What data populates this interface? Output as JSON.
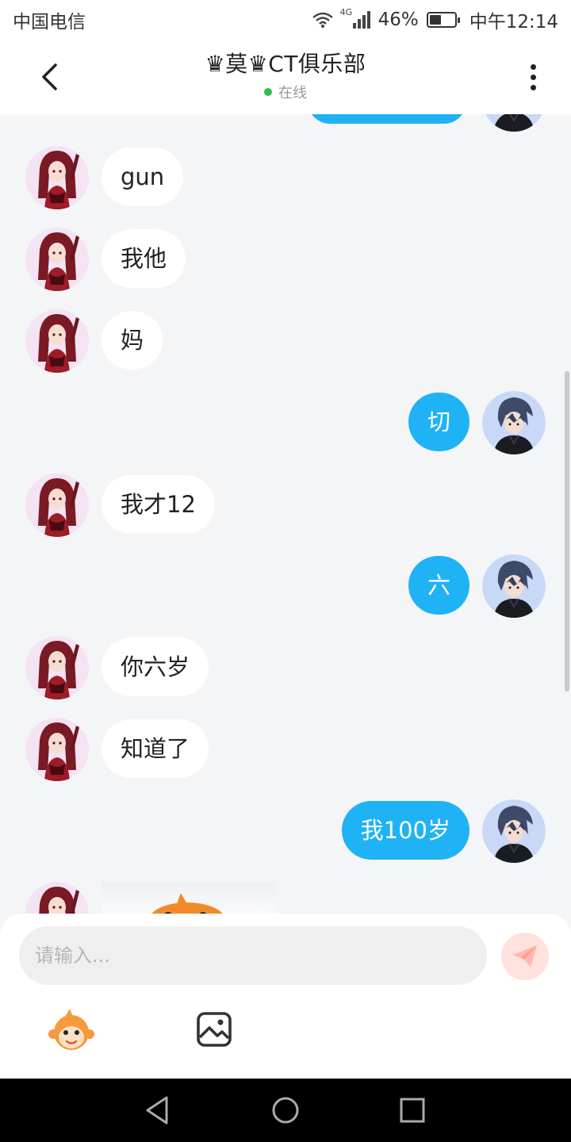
{
  "status_bar": {
    "carrier": "中国电信",
    "network": "4G",
    "battery": "46%",
    "battery_level": 0.46,
    "time": "中午12:14"
  },
  "header": {
    "title": "♛莫♛CT俱乐部",
    "status": "在线"
  },
  "messages": [
    {
      "side": "left",
      "text": "gun"
    },
    {
      "side": "left",
      "text": "我他"
    },
    {
      "side": "left",
      "text": "妈"
    },
    {
      "side": "right",
      "text": "切"
    },
    {
      "side": "left",
      "text": "我才12"
    },
    {
      "side": "right",
      "text": "六"
    },
    {
      "side": "left",
      "text": "你六岁"
    },
    {
      "side": "left",
      "text": "知道了"
    },
    {
      "side": "right",
      "text": "我100岁"
    }
  ],
  "input": {
    "placeholder": "请输入..."
  },
  "colors": {
    "accent": "#1fb3f5",
    "online": "#2fbf4a",
    "background": "#f4f5f7"
  },
  "icons": {
    "back": "chevron-left-icon",
    "more": "more-vertical-icon",
    "send": "send-icon",
    "emoji": "monkey-emoji-icon",
    "image": "image-icon"
  }
}
